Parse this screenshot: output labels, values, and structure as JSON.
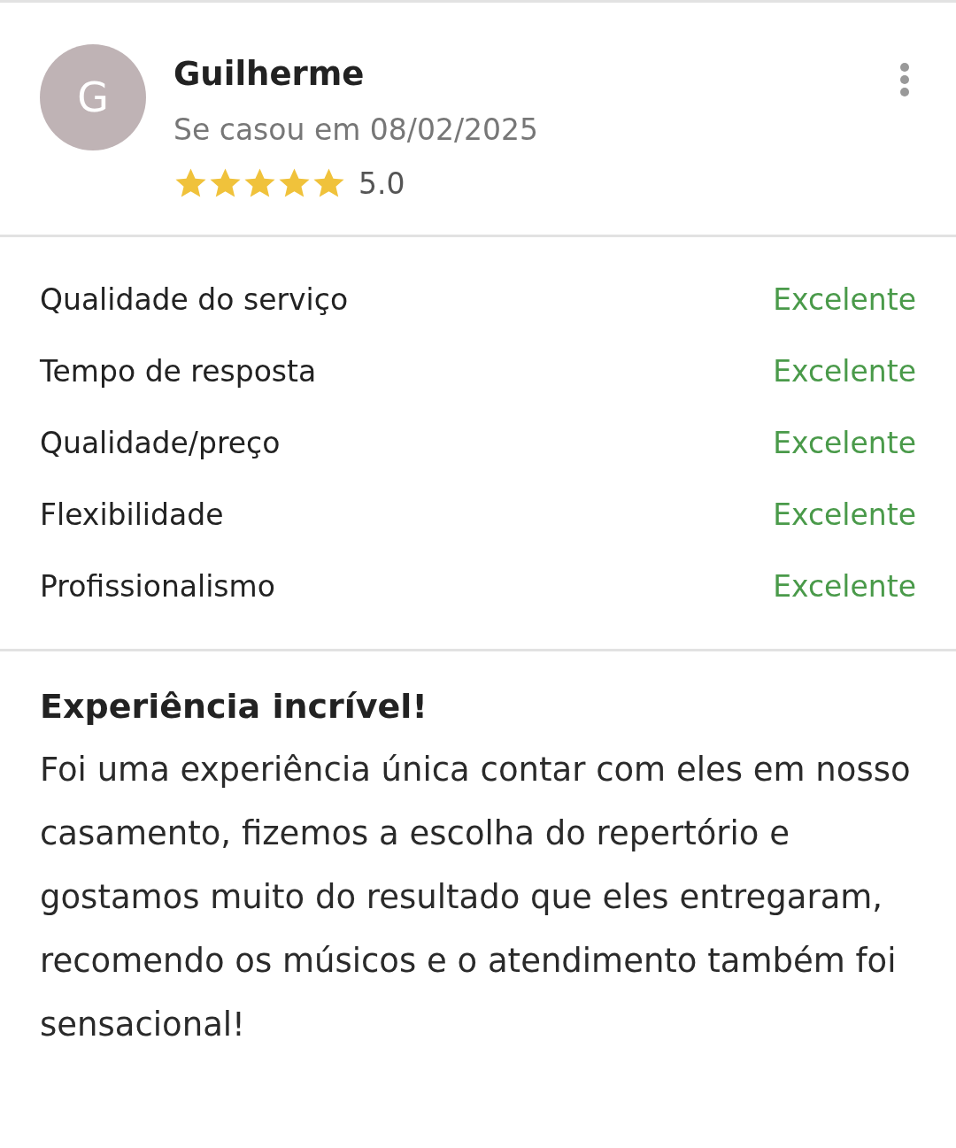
{
  "review": {
    "avatar_letter": "G",
    "name": "Guilherme",
    "date": "Se casou em 08/02/2025",
    "stars": 5,
    "rating": "5.0"
  },
  "ratings": [
    {
      "label": "Qualidade do serviço",
      "value": "Excelente"
    },
    {
      "label": "Tempo de resposta",
      "value": "Excelente"
    },
    {
      "label": "Qualidade/preço",
      "value": "Excelente"
    },
    {
      "label": "Flexibilidade",
      "value": "Excelente"
    },
    {
      "label": "Profissionalismo",
      "value": "Excelente"
    }
  ],
  "title": "Experiência incrível!",
  "body": "Foi uma experiência única contar com eles em nosso casamento, fizemos a escolha do repertório e gostamos muito do resultado que eles entregaram, recomendo os músicos e o atendimento também foi sensacional!"
}
